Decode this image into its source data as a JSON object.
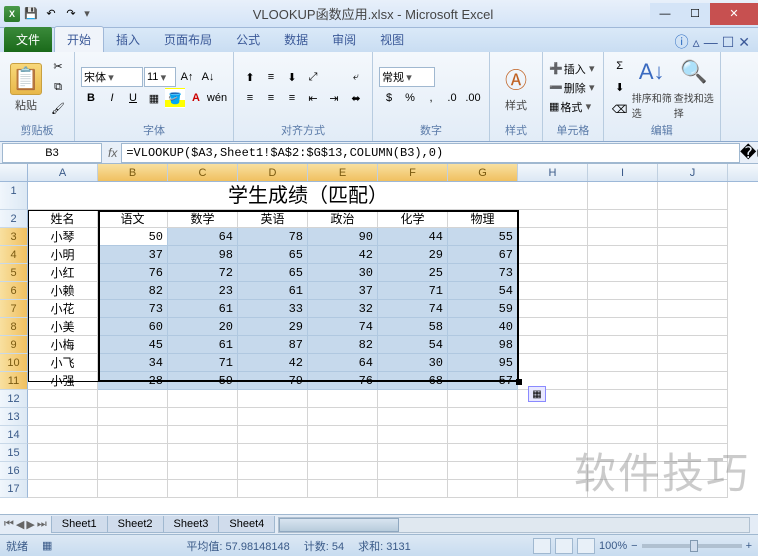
{
  "title": "VLOOKUP函数应用.xlsx - Microsoft Excel",
  "qat": {
    "excel": "X"
  },
  "tabs": {
    "file": "文件",
    "home": "开始",
    "insert": "插入",
    "layout": "页面布局",
    "formulas": "公式",
    "data": "数据",
    "review": "审阅",
    "view": "视图"
  },
  "ribbon": {
    "clipboard": {
      "paste": "粘贴",
      "label": "剪贴板"
    },
    "font": {
      "name": "宋体",
      "size": "11",
      "label": "字体"
    },
    "align": {
      "label": "对齐方式"
    },
    "number": {
      "format": "常规",
      "label": "数字"
    },
    "styles": {
      "label": "样式"
    },
    "cells": {
      "insert": "插入",
      "delete": "删除",
      "format": "格式",
      "label": "单元格"
    },
    "editing": {
      "sort": "排序和筛选",
      "find": "查找和选择",
      "label": "编辑"
    }
  },
  "namebox": "B3",
  "formula": "=VLOOKUP($A3,Sheet1!$A$2:$G$13,COLUMN(B3),0)",
  "columns": [
    "A",
    "B",
    "C",
    "D",
    "E",
    "F",
    "G",
    "H",
    "I",
    "J"
  ],
  "sheet_title": "学生成绩（匹配）",
  "headers": {
    "name": "姓名",
    "subj": [
      "语文",
      "数学",
      "英语",
      "政治",
      "化学",
      "物理"
    ]
  },
  "rows": [
    {
      "name": "小琴",
      "v": [
        50,
        64,
        78,
        90,
        44,
        55
      ]
    },
    {
      "name": "小明",
      "v": [
        37,
        98,
        65,
        42,
        29,
        67
      ]
    },
    {
      "name": "小红",
      "v": [
        76,
        72,
        65,
        30,
        25,
        73
      ]
    },
    {
      "name": "小赖",
      "v": [
        82,
        23,
        61,
        37,
        71,
        54
      ]
    },
    {
      "name": "小花",
      "v": [
        73,
        61,
        33,
        32,
        74,
        59
      ]
    },
    {
      "name": "小美",
      "v": [
        60,
        20,
        29,
        74,
        58,
        40
      ]
    },
    {
      "name": "小梅",
      "v": [
        45,
        61,
        87,
        82,
        54,
        98
      ]
    },
    {
      "name": "小飞",
      "v": [
        34,
        71,
        42,
        64,
        30,
        95
      ]
    },
    {
      "name": "小强",
      "v": [
        28,
        59,
        79,
        76,
        68,
        57
      ]
    }
  ],
  "sheets": [
    "Sheet1",
    "Sheet2",
    "Sheet3",
    "Sheet4"
  ],
  "status": {
    "mode": "就绪",
    "avg_label": "平均值:",
    "avg": "57.98148148",
    "count_label": "计数:",
    "count": "54",
    "sum_label": "求和:",
    "sum": "3131",
    "zoom": "100%"
  },
  "watermark": "软件技巧"
}
